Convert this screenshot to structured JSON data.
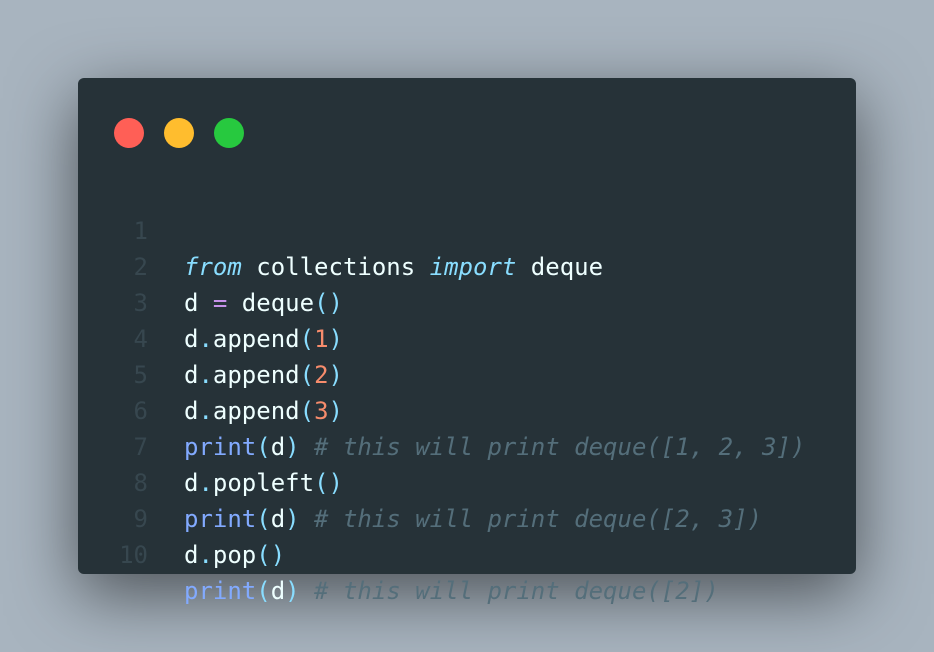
{
  "window": {
    "controls": [
      "close",
      "minimize",
      "maximize"
    ]
  },
  "code": {
    "line_numbers": [
      "1",
      "2",
      "3",
      "4",
      "5",
      "6",
      "7",
      "8",
      "9",
      "10"
    ],
    "lines": [
      {
        "t1": "from",
        "t2": " collections ",
        "t3": "import",
        "t4": " deque"
      },
      {
        "t1": "d ",
        "t2": "=",
        "t3": " deque",
        "t4": "()"
      },
      {
        "t1": "d",
        "t2": ".",
        "t3": "append",
        "t4": "(",
        "t5": "1",
        "t6": ")"
      },
      {
        "t1": "d",
        "t2": ".",
        "t3": "append",
        "t4": "(",
        "t5": "2",
        "t6": ")"
      },
      {
        "t1": "d",
        "t2": ".",
        "t3": "append",
        "t4": "(",
        "t5": "3",
        "t6": ")"
      },
      {
        "t1": "print",
        "t2": "(",
        "t3": "d",
        "t4": ")",
        "t5": " # this will print deque([1, 2, 3])"
      },
      {
        "t1": "d",
        "t2": ".",
        "t3": "popleft",
        "t4": "()"
      },
      {
        "t1": "print",
        "t2": "(",
        "t3": "d",
        "t4": ")",
        "t5": " # this will print deque([2, 3])"
      },
      {
        "t1": "d",
        "t2": ".",
        "t3": "pop",
        "t4": "()"
      },
      {
        "t1": "print",
        "t2": "(",
        "t3": "d",
        "t4": ")",
        "t5": " # this will print deque([2])"
      }
    ]
  },
  "theme": {
    "background": "#263238",
    "page_background": "#a8b4bf",
    "keyword": "#89ddff",
    "operator": "#c792ea",
    "number": "#f78c6c",
    "function": "#82aaff",
    "comment": "#546e7a",
    "text": "#eeffff",
    "line_number": "#37474f",
    "close": "#ff5f56",
    "minimize": "#ffbd2e",
    "maximize": "#27c93f"
  }
}
